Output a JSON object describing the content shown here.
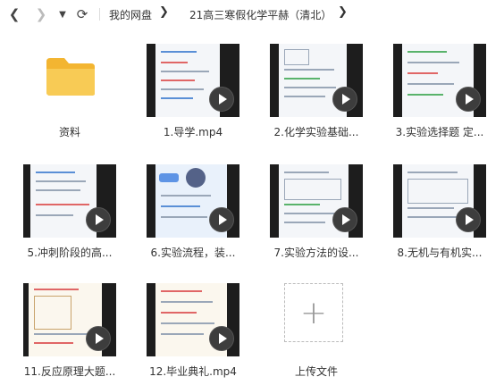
{
  "toolbar": {
    "back_icon": "chevron-left-icon",
    "forward_icon": "chevron-right-icon",
    "dropdown_icon": "caret-down-icon",
    "refresh_icon": "refresh-icon",
    "breadcrumb": [
      "我的网盘",
      "21高三寒假化学平赫（清北）"
    ]
  },
  "folder": {
    "label": "资料",
    "color": "#f7c34a"
  },
  "videos": [
    {
      "label": "1.导学.mp4"
    },
    {
      "label": "2.化学实验基础..."
    },
    {
      "label": "3.实验选择题 定..."
    },
    {
      "label": "5.冲刺阶段的高..."
    },
    {
      "label": "6.实验流程，装..."
    },
    {
      "label": "7.实验方法的设..."
    },
    {
      "label": "8.无机与有机实..."
    },
    {
      "label": "11.反应原理大题..."
    },
    {
      "label": "12.毕业典礼.mp4"
    }
  ],
  "upload": {
    "label": "上传文件"
  }
}
